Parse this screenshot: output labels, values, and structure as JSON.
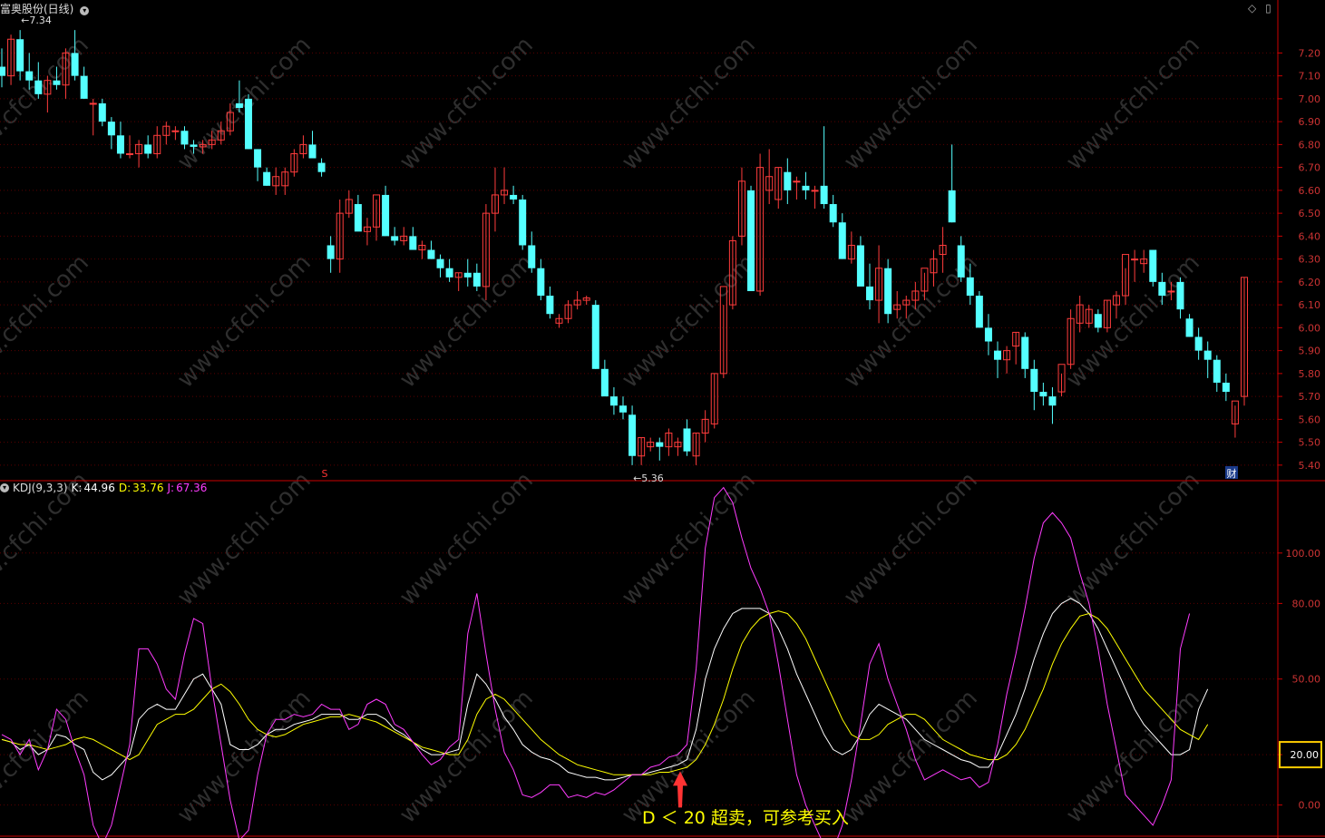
{
  "header": {
    "title": "富奥股份(日线)",
    "max_label": "7.34",
    "min_label": "5.36"
  },
  "kdj": {
    "name": "KDJ(9,3,3)",
    "k_label": "K:",
    "k_value": "44.96",
    "d_label": "D:",
    "d_value": "33.76",
    "j_label": "J:",
    "j_value": "67.36"
  },
  "markers": {
    "s_marker": "S",
    "cai_marker": "财"
  },
  "annotation": "D ＜ 20 超卖，可参考买入",
  "watermark": "www.cfchi.com",
  "colors": {
    "background": "#000000",
    "up": "#ff3c3c",
    "down": "#54ffff",
    "k_line": "#ffffff",
    "d_line": "#ffff00",
    "j_line": "#ff3cff",
    "axis": "#cc0000",
    "highlight": "#ffcc00"
  },
  "chart_data": [
    {
      "type": "candlestick",
      "title": "富奥股份(日线)",
      "y_ticks": [
        "7.20",
        "7.10",
        "7.00",
        "6.90",
        "6.80",
        "6.70",
        "6.60",
        "6.50",
        "6.40",
        "6.30",
        "6.20",
        "6.10",
        "6.00",
        "5.90",
        "5.80",
        "5.70",
        "5.60",
        "5.50",
        "5.40"
      ],
      "ylim": [
        5.34,
        7.36
      ],
      "candles": [
        [
          7.14,
          7.22,
          7.05,
          7.1
        ],
        [
          7.1,
          7.28,
          7.06,
          7.26
        ],
        [
          7.26,
          7.3,
          7.08,
          7.12
        ],
        [
          7.12,
          7.2,
          7.04,
          7.08
        ],
        [
          7.08,
          7.16,
          7.0,
          7.02
        ],
        [
          7.02,
          7.1,
          6.94,
          7.08
        ],
        [
          7.08,
          7.14,
          7.04,
          7.06
        ],
        [
          7.06,
          7.22,
          7.0,
          7.2
        ],
        [
          7.2,
          7.3,
          7.08,
          7.1
        ],
        [
          7.1,
          7.14,
          7.0,
          7.0
        ],
        [
          6.98,
          7.0,
          6.84,
          6.98
        ],
        [
          6.98,
          7.0,
          6.88,
          6.9
        ],
        [
          6.9,
          6.92,
          6.78,
          6.84
        ],
        [
          6.84,
          6.9,
          6.74,
          6.76
        ],
        [
          6.76,
          6.84,
          6.74,
          6.76
        ],
        [
          6.76,
          6.82,
          6.7,
          6.8
        ],
        [
          6.8,
          6.84,
          6.74,
          6.76
        ],
        [
          6.76,
          6.88,
          6.74,
          6.84
        ],
        [
          6.84,
          6.9,
          6.8,
          6.88
        ],
        [
          6.86,
          6.88,
          6.82,
          6.86
        ],
        [
          6.86,
          6.88,
          6.78,
          6.8
        ],
        [
          6.8,
          6.82,
          6.76,
          6.79
        ],
        [
          6.79,
          6.82,
          6.76,
          6.8
        ],
        [
          6.8,
          6.86,
          6.78,
          6.82
        ],
        [
          6.82,
          6.9,
          6.8,
          6.86
        ],
        [
          6.86,
          6.98,
          6.84,
          6.94
        ],
        [
          6.98,
          7.08,
          6.94,
          6.96
        ],
        [
          7.0,
          7.02,
          6.78,
          6.78
        ],
        [
          6.78,
          6.78,
          6.64,
          6.7
        ],
        [
          6.68,
          6.7,
          6.62,
          6.62
        ],
        [
          6.62,
          6.7,
          6.58,
          6.66
        ],
        [
          6.62,
          6.7,
          6.58,
          6.68
        ],
        [
          6.68,
          6.78,
          6.66,
          6.76
        ],
        [
          6.76,
          6.84,
          6.74,
          6.8
        ],
        [
          6.8,
          6.86,
          6.74,
          6.74
        ],
        [
          6.72,
          6.74,
          6.66,
          6.68
        ],
        [
          6.36,
          6.4,
          6.24,
          6.3
        ],
        [
          6.3,
          6.56,
          6.24,
          6.5
        ],
        [
          6.5,
          6.6,
          6.48,
          6.56
        ],
        [
          6.54,
          6.58,
          6.46,
          6.42
        ],
        [
          6.42,
          6.48,
          6.36,
          6.44
        ],
        [
          6.44,
          6.56,
          6.38,
          6.58
        ],
        [
          6.58,
          6.62,
          6.42,
          6.4
        ],
        [
          6.4,
          6.44,
          6.36,
          6.38
        ],
        [
          6.38,
          6.44,
          6.36,
          6.4
        ],
        [
          6.4,
          6.44,
          6.34,
          6.34
        ],
        [
          6.34,
          6.38,
          6.3,
          6.36
        ],
        [
          6.34,
          6.38,
          6.3,
          6.3
        ],
        [
          6.3,
          6.32,
          6.22,
          6.26
        ],
        [
          6.26,
          6.3,
          6.2,
          6.22
        ],
        [
          6.22,
          6.24,
          6.16,
          6.24
        ],
        [
          6.24,
          6.3,
          6.18,
          6.22
        ],
        [
          6.24,
          6.28,
          6.16,
          6.18
        ],
        [
          6.18,
          6.54,
          6.12,
          6.5
        ],
        [
          6.5,
          6.7,
          6.42,
          6.58
        ],
        [
          6.58,
          6.7,
          6.54,
          6.6
        ],
        [
          6.58,
          6.62,
          6.54,
          6.56
        ],
        [
          6.56,
          6.58,
          6.34,
          6.36
        ],
        [
          6.36,
          6.42,
          6.24,
          6.26
        ],
        [
          6.26,
          6.3,
          6.12,
          6.14
        ],
        [
          6.14,
          6.18,
          6.04,
          6.06
        ],
        [
          6.02,
          6.06,
          6.0,
          6.04
        ],
        [
          6.04,
          6.12,
          6.02,
          6.1
        ],
        [
          6.1,
          6.16,
          6.08,
          6.12
        ],
        [
          6.12,
          6.14,
          6.1,
          6.13
        ],
        [
          6.1,
          6.12,
          5.82,
          5.82
        ],
        [
          5.82,
          5.86,
          5.72,
          5.7
        ],
        [
          5.7,
          5.74,
          5.62,
          5.66
        ],
        [
          5.66,
          5.7,
          5.6,
          5.63
        ],
        [
          5.62,
          5.66,
          5.4,
          5.44
        ],
        [
          5.44,
          5.52,
          5.4,
          5.52
        ],
        [
          5.48,
          5.52,
          5.46,
          5.5
        ],
        [
          5.5,
          5.52,
          5.42,
          5.48
        ],
        [
          5.48,
          5.56,
          5.44,
          5.54
        ],
        [
          5.48,
          5.52,
          5.44,
          5.5
        ],
        [
          5.56,
          5.6,
          5.44,
          5.46
        ],
        [
          5.44,
          5.54,
          5.4,
          5.54
        ],
        [
          5.54,
          5.64,
          5.5,
          5.6
        ],
        [
          5.58,
          5.8,
          5.56,
          5.8
        ],
        [
          5.8,
          6.1,
          5.78,
          6.18
        ],
        [
          6.1,
          6.4,
          6.08,
          6.38
        ],
        [
          6.4,
          6.7,
          6.36,
          6.64
        ],
        [
          6.6,
          6.62,
          6.16,
          6.16
        ],
        [
          6.16,
          6.76,
          6.14,
          6.7
        ],
        [
          6.6,
          6.78,
          6.54,
          6.66
        ],
        [
          6.56,
          6.7,
          6.52,
          6.7
        ],
        [
          6.68,
          6.74,
          6.54,
          6.6
        ],
        [
          6.64,
          6.66,
          6.56,
          6.64
        ],
        [
          6.62,
          6.68,
          6.56,
          6.6
        ],
        [
          6.6,
          6.62,
          6.52,
          6.6
        ],
        [
          6.62,
          6.88,
          6.52,
          6.54
        ],
        [
          6.54,
          6.58,
          6.44,
          6.46
        ],
        [
          6.46,
          6.5,
          6.32,
          6.3
        ],
        [
          6.3,
          6.42,
          6.28,
          6.36
        ],
        [
          6.36,
          6.4,
          6.2,
          6.18
        ],
        [
          6.18,
          6.28,
          6.08,
          6.12
        ],
        [
          6.12,
          6.36,
          6.02,
          6.26
        ],
        [
          6.26,
          6.3,
          6.02,
          6.06
        ],
        [
          6.08,
          6.16,
          6.04,
          6.1
        ],
        [
          6.1,
          6.14,
          6.04,
          6.12
        ],
        [
          6.12,
          6.2,
          6.08,
          6.16
        ],
        [
          6.16,
          6.24,
          6.12,
          6.26
        ],
        [
          6.24,
          6.34,
          6.18,
          6.3
        ],
        [
          6.32,
          6.44,
          6.24,
          6.36
        ],
        [
          6.6,
          6.8,
          6.46,
          6.46
        ],
        [
          6.36,
          6.4,
          6.2,
          6.22
        ],
        [
          6.22,
          6.28,
          6.1,
          6.14
        ],
        [
          6.14,
          6.16,
          6.02,
          6.0
        ],
        [
          6.0,
          6.06,
          5.88,
          5.94
        ],
        [
          5.9,
          5.94,
          5.78,
          5.86
        ],
        [
          5.86,
          5.92,
          5.8,
          5.9
        ],
        [
          5.92,
          5.98,
          5.84,
          5.98
        ],
        [
          5.96,
          5.98,
          5.78,
          5.82
        ],
        [
          5.82,
          5.86,
          5.64,
          5.72
        ],
        [
          5.72,
          5.76,
          5.66,
          5.7
        ],
        [
          5.7,
          5.74,
          5.58,
          5.66
        ],
        [
          5.72,
          5.8,
          5.7,
          5.84
        ],
        [
          5.84,
          6.08,
          5.82,
          6.04
        ],
        [
          6.02,
          6.14,
          5.98,
          6.1
        ],
        [
          6.02,
          6.1,
          6.0,
          6.08
        ],
        [
          6.06,
          6.08,
          5.98,
          6.0
        ],
        [
          6.0,
          6.12,
          5.98,
          6.12
        ],
        [
          6.1,
          6.16,
          6.04,
          6.14
        ],
        [
          6.14,
          6.26,
          6.1,
          6.32
        ],
        [
          6.3,
          6.34,
          6.2,
          6.3
        ],
        [
          6.28,
          6.34,
          6.24,
          6.3
        ],
        [
          6.34,
          6.34,
          6.18,
          6.2
        ],
        [
          6.2,
          6.24,
          6.1,
          6.14
        ],
        [
          6.16,
          6.2,
          6.12,
          6.16
        ],
        [
          6.2,
          6.22,
          6.04,
          6.08
        ],
        [
          6.04,
          6.06,
          5.96,
          5.96
        ],
        [
          5.96,
          6.0,
          5.86,
          5.9
        ],
        [
          5.9,
          5.94,
          5.78,
          5.86
        ],
        [
          5.86,
          5.88,
          5.72,
          5.76
        ],
        [
          5.76,
          5.8,
          5.68,
          5.72
        ],
        [
          5.58,
          5.66,
          5.52,
          5.68
        ],
        [
          5.7,
          6.22,
          5.66,
          6.22
        ]
      ],
      "low_label_at": 5.36,
      "high_label_at": 7.34
    },
    {
      "type": "line",
      "title": "KDJ(9,3,3)",
      "y_ticks": [
        "100.00",
        "80.00",
        "50.00",
        "20.00",
        "0.00"
      ],
      "ylim": [
        -12,
        128
      ],
      "series": [
        {
          "name": "K",
          "values": [
            26,
            25,
            22,
            24,
            20,
            22,
            28,
            27,
            24,
            22,
            13,
            10,
            12,
            16,
            20,
            34,
            38,
            40,
            38,
            38,
            44,
            50,
            52,
            46,
            40,
            24,
            22,
            22,
            24,
            28,
            30,
            30,
            32,
            33,
            34,
            36,
            36,
            36,
            34,
            34,
            36,
            36,
            34,
            30,
            28,
            25,
            22,
            20,
            20,
            21,
            22,
            40,
            52,
            48,
            42,
            35,
            30,
            24,
            21,
            19,
            18,
            16,
            13,
            12,
            11,
            11,
            10,
            10,
            11,
            12,
            12,
            13,
            14,
            15,
            16,
            18,
            30,
            50,
            62,
            70,
            76,
            78,
            78,
            78,
            76,
            70,
            62,
            52,
            44,
            36,
            28,
            22,
            20,
            22,
            28,
            36,
            40,
            38,
            36,
            34,
            30,
            26,
            24,
            22,
            20,
            18,
            17,
            15,
            15,
            20,
            28,
            36,
            46,
            58,
            68,
            76,
            80,
            82,
            80,
            76,
            70,
            62,
            54,
            46,
            38,
            32,
            28,
            24,
            20,
            20,
            22,
            38,
            46
          ]
        },
        {
          "name": "D",
          "values": [
            26,
            25,
            24,
            24,
            23,
            22,
            23,
            24,
            26,
            27,
            26,
            24,
            22,
            20,
            18,
            20,
            26,
            32,
            34,
            36,
            36,
            38,
            42,
            46,
            48,
            45,
            40,
            34,
            30,
            28,
            27,
            28,
            30,
            32,
            33,
            34,
            35,
            35,
            36,
            35,
            34,
            33,
            31,
            29,
            27,
            25,
            23,
            22,
            21,
            20,
            20,
            26,
            36,
            42,
            44,
            42,
            38,
            34,
            30,
            26,
            23,
            20,
            18,
            16,
            15,
            14,
            13,
            12,
            12,
            12,
            12,
            12,
            13,
            13,
            14,
            15,
            18,
            24,
            32,
            42,
            54,
            64,
            70,
            74,
            76,
            77,
            76,
            72,
            66,
            58,
            50,
            42,
            34,
            28,
            26,
            26,
            28,
            32,
            34,
            36,
            36,
            34,
            30,
            26,
            24,
            22,
            20,
            19,
            18,
            18,
            20,
            24,
            30,
            38,
            46,
            56,
            64,
            70,
            75,
            76,
            74,
            70,
            64,
            58,
            52,
            46,
            42,
            38,
            34,
            30,
            28,
            26,
            32
          ]
        },
        {
          "name": "J",
          "values": [
            28,
            26,
            20,
            26,
            14,
            22,
            38,
            34,
            22,
            12,
            -8,
            -16,
            -8,
            8,
            24,
            62,
            62,
            56,
            46,
            42,
            60,
            74,
            72,
            46,
            24,
            2,
            -14,
            -10,
            12,
            28,
            34,
            34,
            36,
            35,
            36,
            40,
            38,
            38,
            30,
            32,
            40,
            42,
            40,
            32,
            30,
            25,
            20,
            16,
            18,
            23,
            26,
            68,
            84,
            60,
            38,
            21,
            14,
            4,
            3,
            5,
            8,
            8,
            3,
            4,
            3,
            5,
            4,
            6,
            9,
            12,
            12,
            15,
            16,
            19,
            20,
            24,
            54,
            102,
            122,
            126,
            120,
            106,
            94,
            86,
            76,
            56,
            34,
            12,
            0,
            -8,
            -16,
            -18,
            -8,
            10,
            32,
            56,
            64,
            50,
            40,
            30,
            18,
            10,
            12,
            14,
            12,
            10,
            11,
            7,
            9,
            24,
            44,
            60,
            78,
            98,
            112,
            116,
            112,
            106,
            92,
            80,
            62,
            40,
            22,
            4,
            0,
            -4,
            -8,
            0,
            10,
            62,
            76
          ]
        }
      ],
      "annotation": "D ＜ 20 超卖，可参考买入"
    }
  ]
}
